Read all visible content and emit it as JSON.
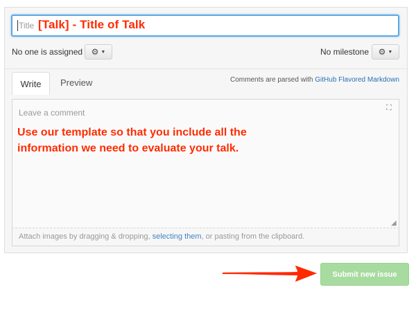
{
  "form": {
    "title_placeholder": "Title",
    "assignee_text": "No one is assigned",
    "milestone_text": "No milestone",
    "comment_placeholder": "Leave a comment"
  },
  "tabs": [
    {
      "label": "Write",
      "active": true
    },
    {
      "label": "Preview",
      "active": false
    }
  ],
  "markdown_note": {
    "prefix": "Comments are parsed with ",
    "link": "GitHub Flavored Markdown"
  },
  "attach": {
    "prefix": "Attach images by dragging & dropping, ",
    "link": "selecting them",
    "suffix": ", or pasting from the clipboard."
  },
  "submit_label": "Submit new issue",
  "annotations": {
    "title_hint": "[Talk] - Title of Talk",
    "body_hint": "Use our template so that you include all the information we need to evaluate your talk."
  },
  "icons": {
    "assignee_gear": "gear-icon",
    "milestone_gear": "gear-icon",
    "expand": "fullscreen-icon",
    "resize": "resize-handle-icon"
  },
  "colors": {
    "annotation": "#ff2a00",
    "submit_bg": "#a8dba0",
    "link": "#4183c4",
    "focus_border": "#5aa8e6"
  }
}
